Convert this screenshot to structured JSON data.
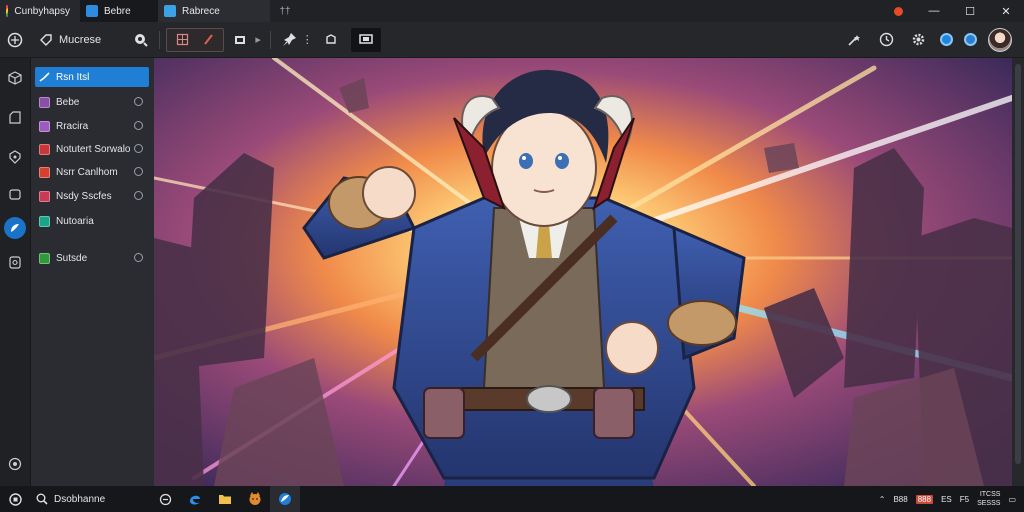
{
  "tabs": [
    {
      "label": "Cunbyhapsy",
      "icon": "app-logo-icon"
    },
    {
      "label": "Bebre",
      "icon": "chat-icon"
    },
    {
      "label": "Rabrece",
      "icon": "image-icon"
    },
    {
      "label": "††",
      "icon": "new-tab-icon"
    }
  ],
  "window_controls": {
    "minimize": "—",
    "maximize": "☐",
    "close": "✕"
  },
  "toolbar": {
    "menu_label": "Mucrese",
    "icons": [
      "palette-icon",
      "tag-icon",
      "search-refresh-icon",
      "layers-icon",
      "frame-icon",
      "more-icon",
      "pin-icon",
      "more-vertical-icon",
      "crop-icon",
      "monitor-icon",
      "magic-wand-icon",
      "history-icon",
      "gear-icon",
      "sync-icon",
      "cloud-icon"
    ]
  },
  "sidebar": {
    "items": [
      {
        "label": "Rsn Itsl",
        "color": "#1f7fd6",
        "selected": true,
        "radio": false
      },
      {
        "label": "Bebe",
        "color": "#8b4fa8",
        "selected": false,
        "radio": true
      },
      {
        "label": "Rracira",
        "color": "#9d5bbf",
        "selected": false,
        "radio": true
      },
      {
        "label": "Notutert Sorwalo",
        "color": "#c8383a",
        "selected": false,
        "radio": true
      },
      {
        "label": "Nsrr Canlhom",
        "color": "#d5402f",
        "selected": false,
        "radio": true
      },
      {
        "label": "Nsdy Sscfes",
        "color": "#c93a55",
        "selected": false,
        "radio": true
      },
      {
        "label": "Nutoaria",
        "color": "#1aa58a",
        "selected": false,
        "radio": false
      },
      {
        "label": "Sutsde",
        "color": "#2f9a3c",
        "selected": false,
        "radio": true
      }
    ]
  },
  "taskbar": {
    "search_label": "Dsobhanne",
    "apps": [
      "chat-bubble-icon",
      "edge-icon",
      "folder-icon",
      "cat-app-icon",
      "browser-icon"
    ],
    "tray_text_1": "B88",
    "tray_chip": "888",
    "tray_text_2": "ES",
    "tray_text_3": "F5",
    "clock_line_1": "ITCSS",
    "clock_line_2": "SESSS"
  },
  "colors": {
    "accent": "#1f7fd6",
    "titlebar": "#202226",
    "panel": "#2a2c31",
    "rail": "#1f2125",
    "taskbar": "#16171a"
  }
}
